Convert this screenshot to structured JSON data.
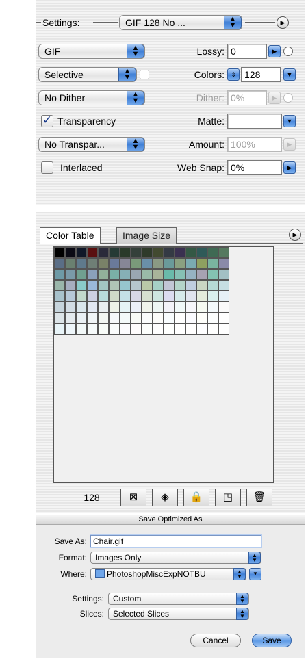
{
  "settings_panel": {
    "settings_label": "Settings:",
    "preset_value": "GIF 128 No ...",
    "format_value": "GIF",
    "lossy_label": "Lossy:",
    "lossy_value": "0",
    "reduction_value": "Selective",
    "colors_label": "Colors:",
    "colors_value": "128",
    "dither_algo_value": "No Dither",
    "dither_label": "Dither:",
    "dither_value": "0%",
    "transparency_label": "Transparency",
    "transparency_checked": true,
    "matte_label": "Matte:",
    "matte_value": "",
    "transparency_dither_value": "No Transpar...",
    "amount_label": "Amount:",
    "amount_value": "100%",
    "interlaced_label": "Interlaced",
    "interlaced_checked": false,
    "web_snap_label": "Web Snap:",
    "web_snap_value": "0%"
  },
  "color_table_panel": {
    "tabs": [
      {
        "label": "Color Table",
        "active": true
      },
      {
        "label": "Image Size",
        "active": false
      }
    ],
    "color_count": "128",
    "swatch_columns": 16,
    "swatches": [
      "#000000",
      "#0a0a14",
      "#101828",
      "#5a1010",
      "#2a2a3a",
      "#253a35",
      "#2a3a2a",
      "#34403a",
      "#2f3a2a",
      "#424a30",
      "#343a44",
      "#3a3050",
      "#345845",
      "#2f5a58",
      "#3f6a54",
      "#55795f",
      "#5a6e86",
      "#6a8070",
      "#5f7a8c",
      "#6f7f76",
      "#7a8268",
      "#6a7a9a",
      "#868696",
      "#7a9a7a",
      "#6a8fa8",
      "#8a9a84",
      "#6a9a9a",
      "#8aa080",
      "#7aaab0",
      "#8ea060",
      "#7ab4a0",
      "#8a8aa8",
      "#6e9aa6",
      "#7a9aa8",
      "#70a090",
      "#8aa0ba",
      "#92b09a",
      "#7ab0a6",
      "#86b0b6",
      "#9aa6b2",
      "#9abaa8",
      "#a8b49a",
      "#6abaaa",
      "#86c0b4",
      "#96b2c2",
      "#a6a2b2",
      "#84c2b2",
      "#a2c0c4",
      "#9ab6aa",
      "#a6aec0",
      "#8acaca",
      "#9ab8da",
      "#a2c6c2",
      "#b0c4b6",
      "#96c6ce",
      "#b6c6ce",
      "#bac8a8",
      "#a6d0c6",
      "#c2c6d6",
      "#b4d4ca",
      "#c0cee0",
      "#cad6c4",
      "#b6dad6",
      "#c6dee2",
      "#a8c2cc",
      "#b6c8d8",
      "#c2d8cc",
      "#ccd0e2",
      "#b8dcdc",
      "#d0dac8",
      "#c4e0e6",
      "#d8d8e6",
      "#d6e0d0",
      "#cee6e0",
      "#dcdcf0",
      "#d6eaea",
      "#e0e4ee",
      "#e4ecdc",
      "#daf0ee",
      "#e6f0f6",
      "#c6d4dc",
      "#d2dce4",
      "#dae6ec",
      "#e2e8f2",
      "#e8eef0",
      "#eef2e8",
      "#e6f4f6",
      "#ecf0f8",
      "#f0f4ec",
      "#eef6f4",
      "#f2f2f8",
      "#f0f8f8",
      "#f6f6fa",
      "#f6faf2",
      "#f4fafc",
      "#fafafa",
      "#dce4e8",
      "#e4eaee",
      "#eaf0f4",
      "#f0f4f6",
      "#f2f6f2",
      "#f6f8fa",
      "#f4fafa",
      "#f8faf6",
      "#fafcfc",
      "#fcfcfa",
      "#f8fcfe",
      "#fefefe",
      "#fafafe",
      "#fefefa",
      "#fcfefe",
      "#ffffff",
      "#e8f4f8",
      "#eef6fa",
      "#f2f8f8",
      "#f6fafa",
      "#f8fcf8",
      "#fafcfc",
      "#fcfcfe",
      "#fefcfc",
      "#fcfefc",
      "#fefefe",
      "#fefffe",
      "#ffffff",
      "#fffefe",
      "#fefeff",
      "#fffffe",
      "#ffffff"
    ]
  },
  "save_dialog": {
    "title": "Save Optimized As",
    "save_as_label": "Save As:",
    "save_as_value": "Chair.gif",
    "format_label": "Format:",
    "format_value": "Images Only",
    "where_label": "Where:",
    "where_value": "PhotoshopMiscExpNOTBU",
    "settings_label": "Settings:",
    "settings_value": "Custom",
    "slices_label": "Slices:",
    "slices_value": "Selected Slices",
    "cancel_label": "Cancel",
    "save_label": "Save"
  },
  "colors": {
    "aqua_blue": "#3f7fd6",
    "panel_bg": "#ececec"
  }
}
